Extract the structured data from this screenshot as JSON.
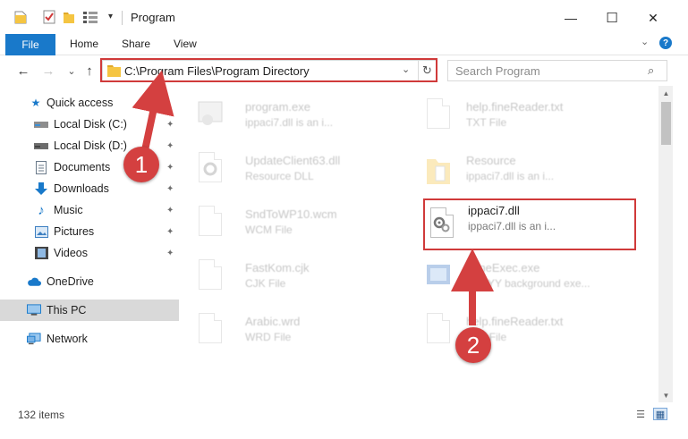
{
  "window": {
    "title": "Program",
    "minimize_glyph": "—",
    "maximize_glyph": "☐",
    "close_glyph": "✕",
    "qa_dropdown": "▾"
  },
  "ribbon": {
    "file_tab": "File",
    "tabs": [
      "Home",
      "Share",
      "View"
    ],
    "collapse_glyph": "⌄",
    "help_glyph": "?"
  },
  "nav": {
    "back": "←",
    "forward": "→",
    "recent": "⌄",
    "up": "↑"
  },
  "address": {
    "path": "C:\\Program Files\\Program Directory",
    "dropdown_glyph": "⌄",
    "refresh_glyph": "↻"
  },
  "search": {
    "placeholder": "Search Program",
    "icon_glyph": "⌕"
  },
  "sidebar": {
    "items": [
      {
        "label": "Quick access",
        "icon": "star-icon",
        "glyph": "★",
        "color": "#1979ca"
      },
      {
        "label": "Local Disk (C:)",
        "icon": "drive-icon",
        "glyph": "▬",
        "color": "#555555",
        "pinned": true
      },
      {
        "label": "Local Disk (D:)",
        "icon": "drive-icon",
        "glyph": "▬",
        "color": "#555555",
        "pinned": true
      },
      {
        "label": "Documents",
        "icon": "document-icon",
        "glyph": "▤",
        "color": "#5a6a7a",
        "pinned": true
      },
      {
        "label": "Downloads",
        "icon": "download-icon",
        "glyph": "⬇",
        "color": "#1979ca",
        "pinned": true
      },
      {
        "label": "Music",
        "icon": "music-icon",
        "glyph": "♪",
        "color": "#1979ca",
        "pinned": true
      },
      {
        "label": "Pictures",
        "icon": "pictures-icon",
        "glyph": "▣",
        "color": "#3d7fc1",
        "pinned": true
      },
      {
        "label": "Videos",
        "icon": "video-icon",
        "glyph": "▦",
        "color": "#444444",
        "pinned": true
      },
      {
        "label": "OneDrive",
        "icon": "cloud-icon",
        "glyph": "☁",
        "color": "#1979ca"
      },
      {
        "label": "This PC",
        "icon": "computer-icon",
        "glyph": "▭",
        "color": "#1979ca",
        "selected": true
      },
      {
        "label": "Network",
        "icon": "network-icon",
        "glyph": "▭",
        "color": "#1979ca"
      }
    ],
    "pin_glyph": "📌"
  },
  "files": [
    {
      "name": "program.exe",
      "desc": "ippaci7.dll is an i...",
      "icon": "exe-icon",
      "faded": true
    },
    {
      "name": "help.fineReader.txt",
      "desc": "TXT File",
      "icon": "txt-file-icon",
      "faded": true
    },
    {
      "name": "UpdateClient63.dll",
      "desc": "Resource DLL",
      "icon": "dll-file-icon",
      "faded": true
    },
    {
      "name": "Resource",
      "desc": "ippaci7.dll is an i...",
      "icon": "folder-icon",
      "faded": true
    },
    {
      "name": "SndToWP10.wcm",
      "desc": "WCM File",
      "icon": "wcm-file-icon",
      "faded": true
    },
    {
      "name": "ippaci7.dll",
      "desc": "ippaci7.dll is an i...",
      "icon": "dll-gear-icon",
      "faded": false
    },
    {
      "name": "FastKom.cjk",
      "desc": "CJK File",
      "icon": "cjk-file-icon",
      "faded": true
    },
    {
      "name": "AlineExec.exe",
      "desc": "ABBYY background exe...",
      "icon": "exe-icon",
      "faded": true
    },
    {
      "name": "Arabic.wrd",
      "desc": "WRD File",
      "icon": "wrd-file-icon",
      "faded": true
    },
    {
      "name": "help.fineReader.txt",
      "desc": "TXT File",
      "icon": "txt-file-icon",
      "faded": true
    }
  ],
  "status": {
    "item_count": "132 items",
    "details_glyph": "☰",
    "tiles_glyph": "▦"
  },
  "callouts": [
    {
      "label": "1"
    },
    {
      "label": "2"
    }
  ],
  "colors": {
    "accent": "#1979ca",
    "highlight": "#d03a3a",
    "callout": "#d44040",
    "folder": "#f5c542"
  }
}
